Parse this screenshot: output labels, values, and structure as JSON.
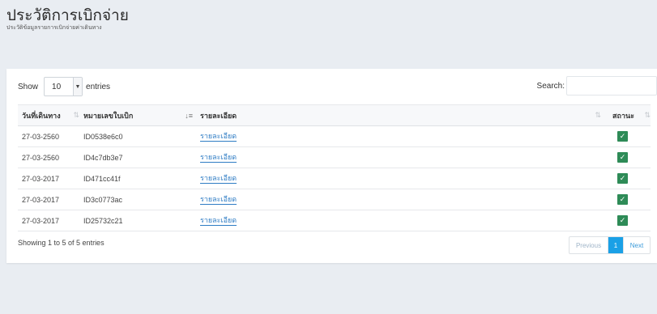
{
  "header": {
    "title": "ประวัติการเบิกจ่าย",
    "subtitle": "ประวัติข้อมูลรายการเบิกจ่ายค่าเดินทาง"
  },
  "controls": {
    "show_label": "Show",
    "entries_value": "10",
    "entries_label": "entries",
    "search_label": "Search:",
    "search_value": ""
  },
  "table": {
    "columns": [
      "วันที่เดินทาง",
      "หมายเลขใบเบิก",
      "รายละเอียด",
      "สถานะ"
    ],
    "rows": [
      {
        "date": "27-03-2560",
        "id": "ID0538e6c0",
        "detail": "รายละเอียด",
        "status": "approved"
      },
      {
        "date": "27-03-2560",
        "id": "ID4c7db3e7",
        "detail": "รายละเอียด",
        "status": "approved"
      },
      {
        "date": "27-03-2017",
        "id": "ID471cc41f",
        "detail": "รายละเอียด",
        "status": "approved"
      },
      {
        "date": "27-03-2017",
        "id": "ID3c0773ac",
        "detail": "รายละเอียด",
        "status": "approved"
      },
      {
        "date": "27-03-2017",
        "id": "ID25732c21",
        "detail": "รายละเอียด",
        "status": "approved"
      }
    ]
  },
  "footer": {
    "info": "Showing 1 to 5 of 5 entries",
    "previous": "Previous",
    "page": "1",
    "next": "Next"
  },
  "icons": {
    "status": "check-icon",
    "sort": "sort-icon",
    "dropdown": "chevron-down-icon"
  },
  "colors": {
    "accent": "#1aa0e6",
    "status_green": "#2e8b57",
    "link": "#2e7cc4"
  }
}
